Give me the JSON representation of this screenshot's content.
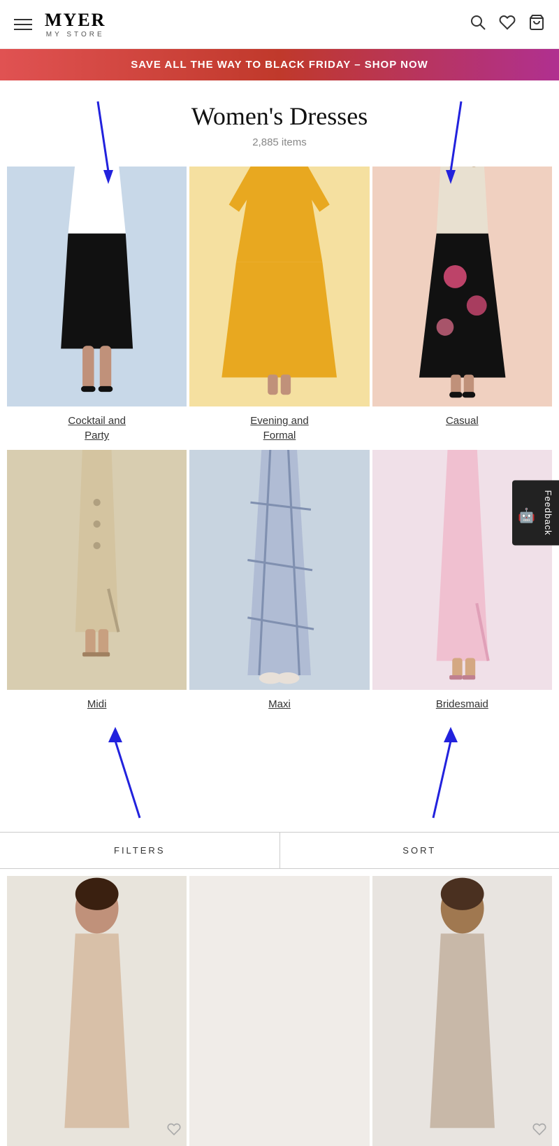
{
  "header": {
    "logo": "MYER",
    "tagline": "MY STORE",
    "icons": {
      "search": "🔍",
      "wishlist": "♡",
      "cart": "🛍"
    }
  },
  "banner": {
    "text": "SAVE ALL THE WAY TO BLACK FRIDAY – SHOP NOW"
  },
  "page": {
    "title": "Women's Dresses",
    "item_count": "2,885 items"
  },
  "categories": [
    {
      "id": "cocktail",
      "label": "Cocktail and\nParty",
      "bg": "#c8d8e8"
    },
    {
      "id": "evening",
      "label": "Evening and\nFormal",
      "bg": "#f5e0a0"
    },
    {
      "id": "casual",
      "label": "Casual",
      "bg": "#f0d0c0"
    },
    {
      "id": "midi",
      "label": "Midi",
      "bg": "#d8cdb0"
    },
    {
      "id": "maxi",
      "label": "Maxi",
      "bg": "#c8d4e0"
    },
    {
      "id": "bridesmaid",
      "label": "Bridesmaid",
      "bg": "#f0e0e8"
    }
  ],
  "bottom_bar": {
    "filters_label": "FILTERS",
    "sort_label": "SORT"
  },
  "feedback": {
    "label": "Feedback"
  }
}
